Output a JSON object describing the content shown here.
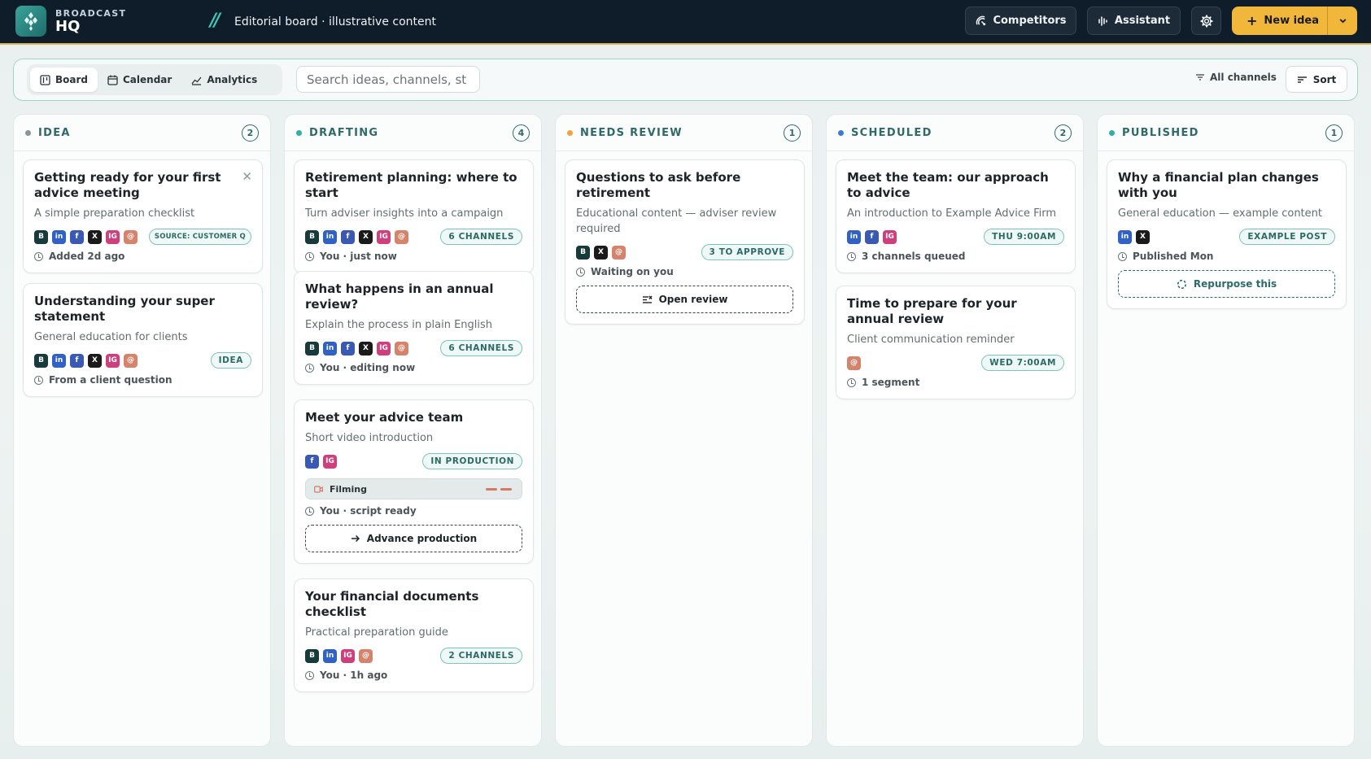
{
  "brand": {
    "top": "BROADCAST",
    "main": "HQ"
  },
  "breadcrumb": {
    "slash": "//",
    "text": "Editorial board · illustrative content"
  },
  "topbar": {
    "competitors": "Competitors",
    "assistant": "Assistant",
    "new_idea": "New idea"
  },
  "toolbar": {
    "tabs": [
      {
        "label": "Board"
      },
      {
        "label": "Calendar"
      },
      {
        "label": "Analytics"
      }
    ],
    "search_placeholder": "Search ideas, channels, st",
    "filter": "All channels",
    "sort": "Sort"
  },
  "colors": {
    "accent_gold": "#f1b73a",
    "teal": "#2e6a6b",
    "channel_b": "#173b3a",
    "channel_in": "#2f62c4",
    "channel_f": "#3a59b4",
    "channel_x": "#1a1a1a",
    "channel_ig": "#cf3f7c",
    "channel_at": "#d7836b"
  },
  "columns": [
    {
      "title": "IDEA",
      "count": "2",
      "dot": "#8a9497",
      "cards": [
        {
          "title": "Getting ready for your first advice meeting",
          "sub": "A simple preparation checklist",
          "channels": [
            "B",
            "in",
            "f",
            "X",
            "IG",
            "@"
          ],
          "badge": "SOURCE: CUSTOMER Q",
          "meta": "Added 2d ago"
        },
        {
          "title": "Understanding your super statement",
          "sub": "General education for clients",
          "channels": [
            "B",
            "in",
            "f",
            "X",
            "IG",
            "@"
          ],
          "badge": "IDEA",
          "meta": "From a client question"
        }
      ]
    },
    {
      "title": "DRAFTING",
      "count": "4",
      "dot": "#2fb0a4",
      "cards": [
        {
          "title": "Retirement planning: where to start",
          "sub": "Turn adviser insights into a campaign",
          "channels": [
            "B",
            "in",
            "f",
            "X",
            "IG",
            "@"
          ],
          "badge": "6 CHANNELS",
          "meta": "You · just now"
        },
        {
          "title": "What happens in an annual review?",
          "sub": "Explain the process in plain English",
          "channels": [
            "B",
            "in",
            "f",
            "X",
            "IG",
            "@"
          ],
          "badge": "6 CHANNELS",
          "meta": "You · editing now"
        },
        {
          "title": "Meet your advice team",
          "sub": "Short video introduction",
          "channels": [
            "f",
            "IG"
          ],
          "badge": "IN PRODUCTION",
          "progress": "Filming",
          "meta": "You · script ready",
          "action": "Advance production"
        },
        {
          "title": "Your financial documents checklist",
          "sub": "Practical preparation guide",
          "channels": [
            "B",
            "in",
            "IG",
            "@"
          ],
          "badge": "2 CHANNELS",
          "meta": "You · 1h ago"
        }
      ]
    },
    {
      "title": "NEEDS REVIEW",
      "count": "1",
      "dot": "#f1a23a",
      "cards": [
        {
          "title": "Questions to ask before retirement",
          "sub": "Educational content — adviser review required",
          "channels": [
            "B",
            "X",
            "@"
          ],
          "badge": "3 TO APPROVE",
          "meta": "Waiting on you",
          "action": "Open review"
        }
      ]
    },
    {
      "title": "SCHEDULED",
      "count": "2",
      "dot": "#3a7bd5",
      "cards": [
        {
          "title": "Meet the team: our approach to advice",
          "sub": "An introduction to Example Advice Firm",
          "channels": [
            "in",
            "f",
            "IG"
          ],
          "badge": "THU 9:00AM",
          "meta": "3 channels queued"
        },
        {
          "title": "Time to prepare for your annual review",
          "sub": "Client communication reminder",
          "channels": [
            "@"
          ],
          "badge": "WED 7:00AM",
          "meta": "1 segment"
        }
      ]
    },
    {
      "title": "PUBLISHED",
      "count": "1",
      "dot": "#2fb0a4",
      "cards": [
        {
          "title": "Why a financial plan changes with you",
          "sub": "General education — example content",
          "channels": [
            "in",
            "X"
          ],
          "badge": "EXAMPLE POST",
          "meta": "Published Mon",
          "action": "Repurpose this"
        }
      ]
    }
  ]
}
